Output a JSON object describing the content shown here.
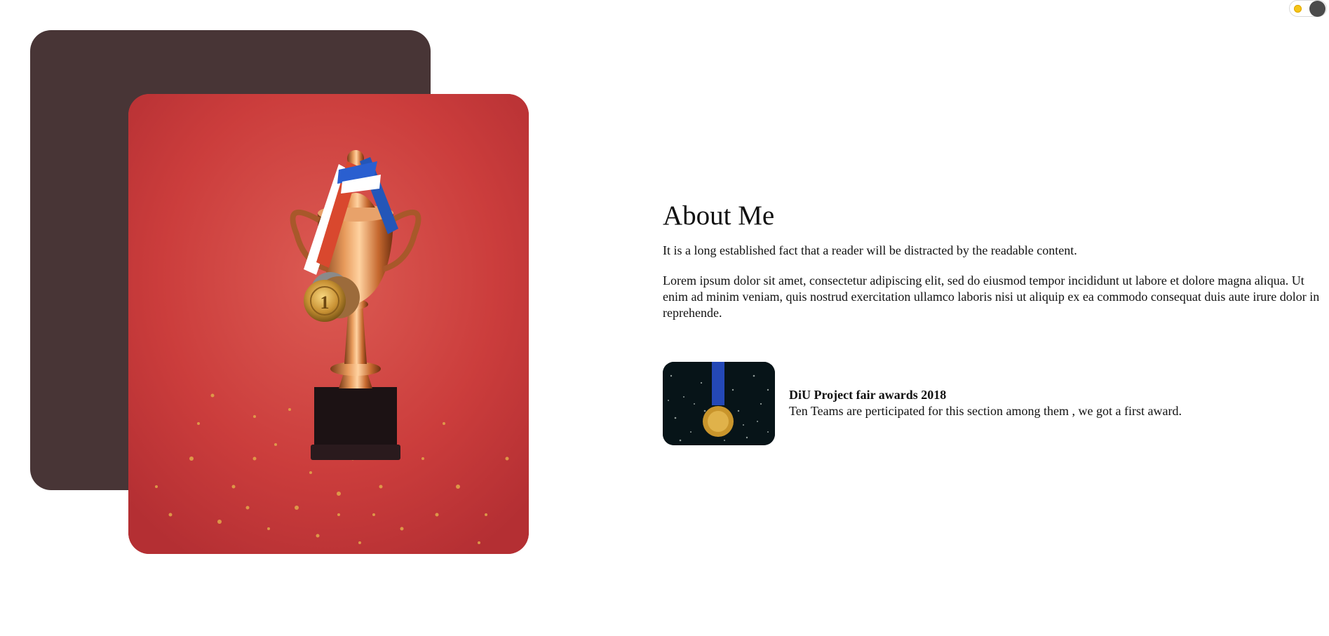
{
  "theme_toggle": {
    "sun_icon": "sun-icon",
    "knob_color": "#4b4b4b",
    "sun_color": "#f5c518"
  },
  "hero": {
    "backdrop_color": "#483536",
    "photo_bg_color": "#c93b3a",
    "photo_subject": "trophy-with-medals"
  },
  "about": {
    "title": "About Me",
    "lead": "It is a long established fact that a reader will be distracted by the readable content.",
    "body": "Lorem ipsum dolor sit amet, consectetur adipiscing elit, sed do eiusmod tempor incididunt ut labore et dolore magna aliqua. Ut enim ad minim veniam, quis nostrud exercitation ullamco laboris nisi ut aliquip ex ea commodo consequat duis aute irure dolor in reprehende."
  },
  "award": {
    "title": "DiU Project fair awards 2018",
    "description": "Ten Teams are perticipated for this section among them , we got a first award.",
    "thumb_subject": "gold-medal"
  }
}
